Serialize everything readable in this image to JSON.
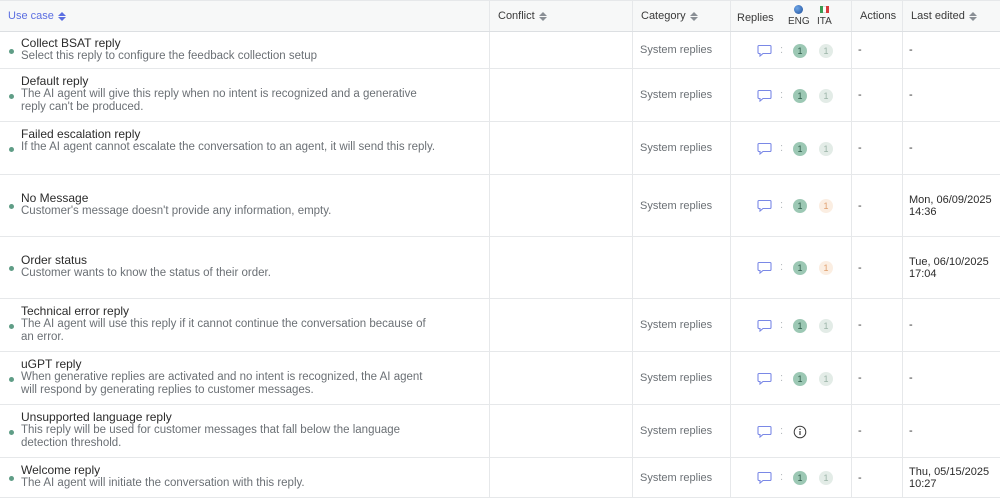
{
  "header": {
    "use_case": "Use case",
    "conflict": "Conflict",
    "category": "Category",
    "replies": "Replies",
    "lang_eng": "ENG",
    "lang_ita": "ITA",
    "actions": "Actions",
    "last_edited": "Last edited"
  },
  "rows": [
    {
      "title": "Collect BSAT reply",
      "desc": "Select this reply to configure the feedback collection setup",
      "category": "System replies",
      "eng": "1",
      "ita": "1",
      "ita_warn": false,
      "actions": "-",
      "edited_1": "-",
      "edited_2": ""
    },
    {
      "title": "Default reply",
      "desc": "The AI agent will give this reply when no intent is recognized and a generative reply can't be produced.",
      "category": "System replies",
      "eng": "1",
      "ita": "1",
      "ita_warn": false,
      "actions": "-",
      "edited_1": "-",
      "edited_2": ""
    },
    {
      "title": "Failed escalation reply",
      "desc": "If the AI agent cannot escalate the conversation to an agent, it will send this reply.",
      "category": "System replies",
      "eng": "1",
      "ita": "1",
      "ita_warn": false,
      "actions": "-",
      "edited_1": "-",
      "edited_2": ""
    },
    {
      "title": "No Message",
      "desc": "Customer's message doesn't provide any information, empty.",
      "category": "System replies",
      "eng": "1",
      "ita": "1",
      "ita_warn": true,
      "actions": "-",
      "edited_1": "Mon, 06/09/2025",
      "edited_2": "14:36"
    },
    {
      "title": "Order status",
      "desc": "Customer wants to know the status of their order.",
      "category": "",
      "eng": "1",
      "ita": "1",
      "ita_warn": true,
      "actions": "-",
      "edited_1": "Tue, 06/10/2025",
      "edited_2": "17:04"
    },
    {
      "title": "Technical error reply",
      "desc": "The AI agent will use this reply if it cannot continue the conversation because of an error.",
      "category": "System replies",
      "eng": "1",
      "ita": "1",
      "ita_warn": false,
      "actions": "-",
      "edited_1": "-",
      "edited_2": ""
    },
    {
      "title": "uGPT reply",
      "desc": "When generative replies are activated and no intent is recognized, the AI agent will respond by generating replies to customer messages.",
      "category": "System replies",
      "eng": "1",
      "ita": "1",
      "ita_warn": false,
      "actions": "-",
      "edited_1": "-",
      "edited_2": ""
    },
    {
      "title": "Unsupported language reply",
      "desc": "This reply will be used for customer messages that fall below the language detection threshold.",
      "category": "System replies",
      "eng": "",
      "ita": "",
      "ita_warn": false,
      "info": true,
      "actions": "-",
      "edited_1": "-",
      "edited_2": ""
    },
    {
      "title": "Welcome reply",
      "desc": "The AI agent will initiate the conversation with this reply.",
      "category": "System replies",
      "eng": "1",
      "ita": "1",
      "ita_warn": false,
      "actions": "-",
      "edited_1": "Thu, 05/15/2025",
      "edited_2": "10:27"
    }
  ],
  "colors": {
    "accent": "#5b6ee1",
    "status_dot": "#5f9d86",
    "eng_badge": "#9cc8b4",
    "ita_badge": "#e3ece7",
    "ita_warn": "#fbeee2",
    "chat_icon": "#5b6ee1"
  },
  "icons": {
    "reply": "chat-bubble-icon",
    "missing": "info-circle-icon",
    "eng": "globe-icon",
    "ita": "italy-flag-icon",
    "sort": "sort-icon"
  }
}
